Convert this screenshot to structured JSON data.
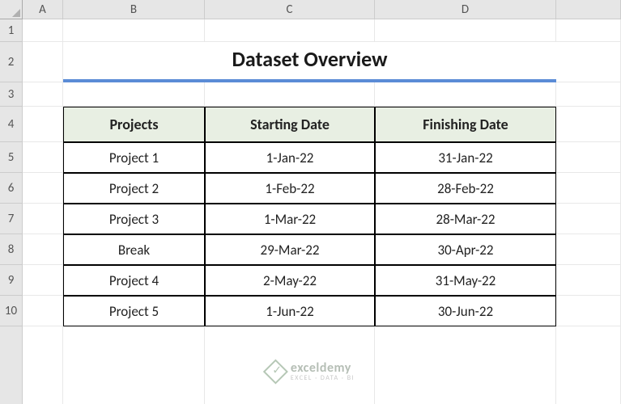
{
  "columns": [
    "A",
    "B",
    "C",
    "D"
  ],
  "rows": [
    "1",
    "2",
    "3",
    "4",
    "5",
    "6",
    "7",
    "8",
    "9",
    "10"
  ],
  "title": "Dataset Overview",
  "chart_data": {
    "type": "table",
    "title": "Dataset Overview",
    "headers": [
      "Projects",
      "Starting Date",
      "Finishing Date"
    ],
    "rows": [
      [
        "Project 1",
        "1-Jan-22",
        "31-Jan-22"
      ],
      [
        "Project 2",
        "1-Feb-22",
        "28-Feb-22"
      ],
      [
        "Project 3",
        "1-Mar-22",
        "28-Mar-22"
      ],
      [
        "Break",
        "29-Mar-22",
        "30-Apr-22"
      ],
      [
        "Project 4",
        "2-May-22",
        "31-May-22"
      ],
      [
        "Project 5",
        "1-Jun-22",
        "30-Jun-22"
      ]
    ]
  },
  "watermark": {
    "main": "exceldemy",
    "sub": "EXCEL · DATA · BI"
  }
}
